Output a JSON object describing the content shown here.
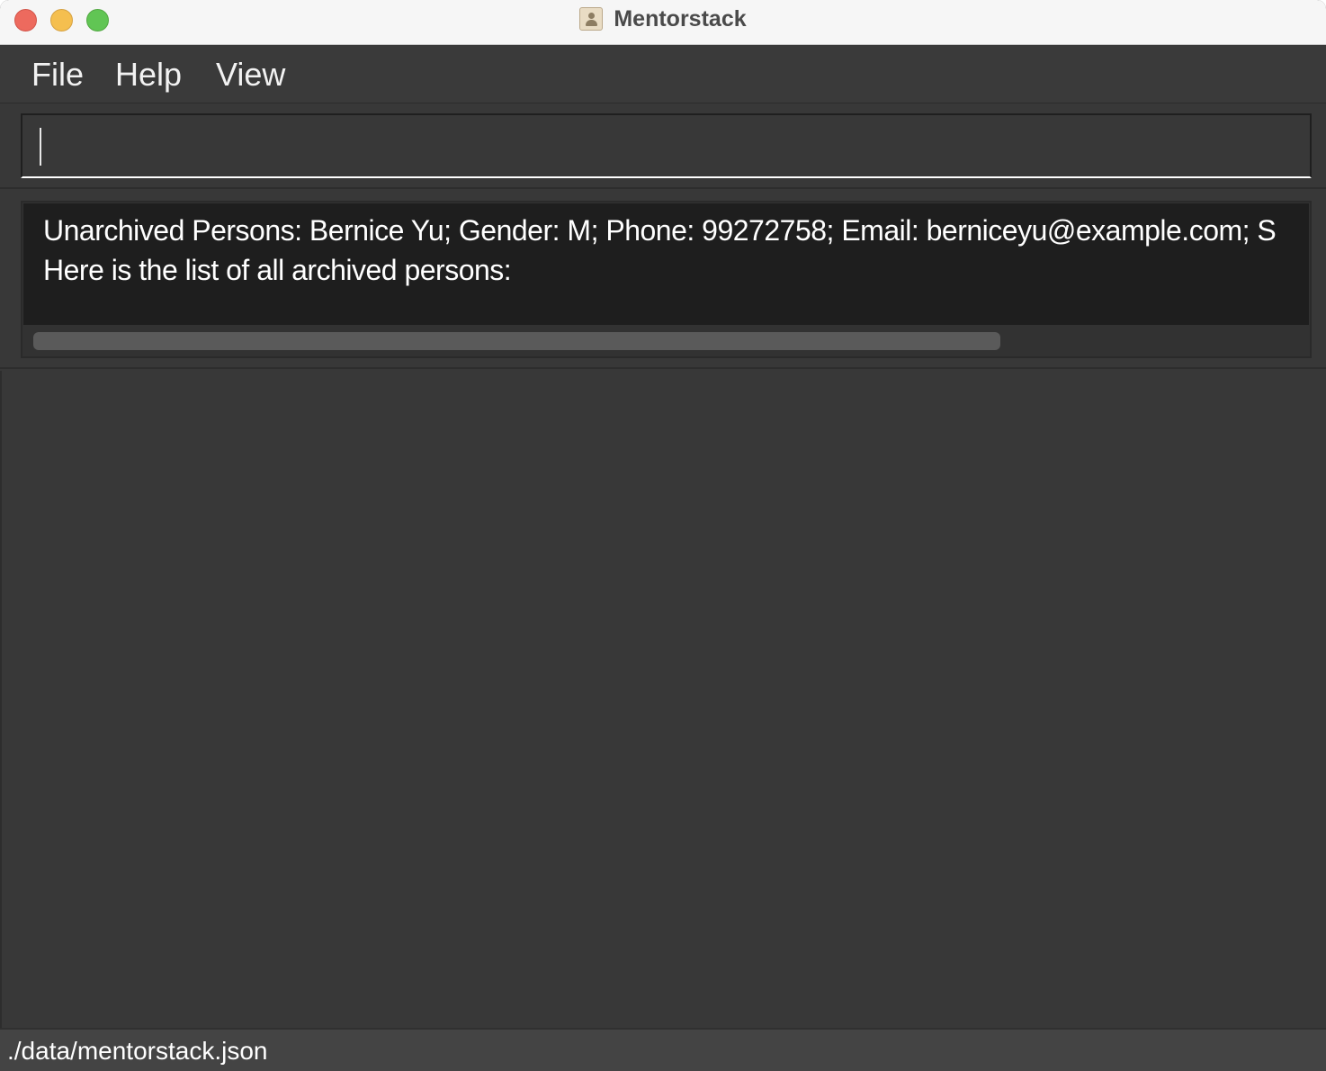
{
  "window": {
    "title": "Mentorstack"
  },
  "menu": {
    "file": "File",
    "help": "Help",
    "view": "View"
  },
  "command_box": {
    "value": ""
  },
  "result_display": {
    "line1": "Unarchived Persons: Bernice Yu; Gender: M; Phone: 99272758; Email: berniceyu@example.com; S",
    "line2": "Here is the list of all archived persons:"
  },
  "status_bar": {
    "file_path": "./data/mentorstack.json"
  },
  "colors": {
    "background": "#383838",
    "result_background": "#1e1e1e",
    "titlebar": "#f6f6f6",
    "close": "#ed6a5e",
    "minimize": "#f5bf4f",
    "maximize": "#61c554"
  },
  "icons": {
    "app": "contacts-book-icon"
  }
}
